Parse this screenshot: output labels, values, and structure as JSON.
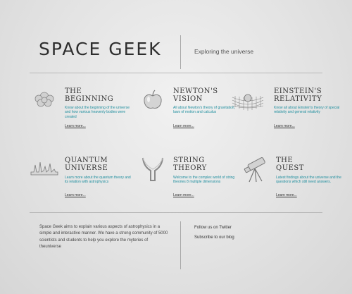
{
  "header": {
    "title": "SPACE GEEK",
    "tagline": "Exploring the universe"
  },
  "features": [
    {
      "icon": "brain-icon",
      "title": [
        "The",
        "Beginning"
      ],
      "description": "Know about the beginning of the universe and how various heavenly bodies were created",
      "link": "Learn more..."
    },
    {
      "icon": "apple-icon",
      "title": [
        "Newton's",
        "Vision"
      ],
      "description": "All about Newton's theory of gravitation, laws of motion and calculus",
      "link": "Learn more..."
    },
    {
      "icon": "spacetime-grid-icon",
      "title": [
        "Einstein's",
        "Relativity"
      ],
      "description": "Know all about Einstein's theory of special relativity and general relativity",
      "link": "Learn more..."
    },
    {
      "icon": "wave-graph-icon",
      "title": [
        "Quantum",
        "Universe"
      ],
      "description": "Learn more about the quantum theory and its relation with astrophysics",
      "link": "Learn more..."
    },
    {
      "icon": "string-fork-icon",
      "title": [
        "String",
        "Theory"
      ],
      "description": "Welcome to the complex world of string theories 8 multiple dimensions",
      "link": "Learn more..."
    },
    {
      "icon": "telescope-icon",
      "title": [
        "The",
        "Quest"
      ],
      "description": "Latest findings about the universe and the questions which still need answers.",
      "link": "Learn more..."
    }
  ],
  "footer": {
    "about": "Space Geek aims to explain various aspects of astrophysics in a simple and interactive manner. We have a strong community of 5000 scientists and students to help you explore the myteries of theuniverse",
    "follow_twitter": "Follow us on Twitter",
    "subscribe_blog": "Subscribe to our blog"
  }
}
